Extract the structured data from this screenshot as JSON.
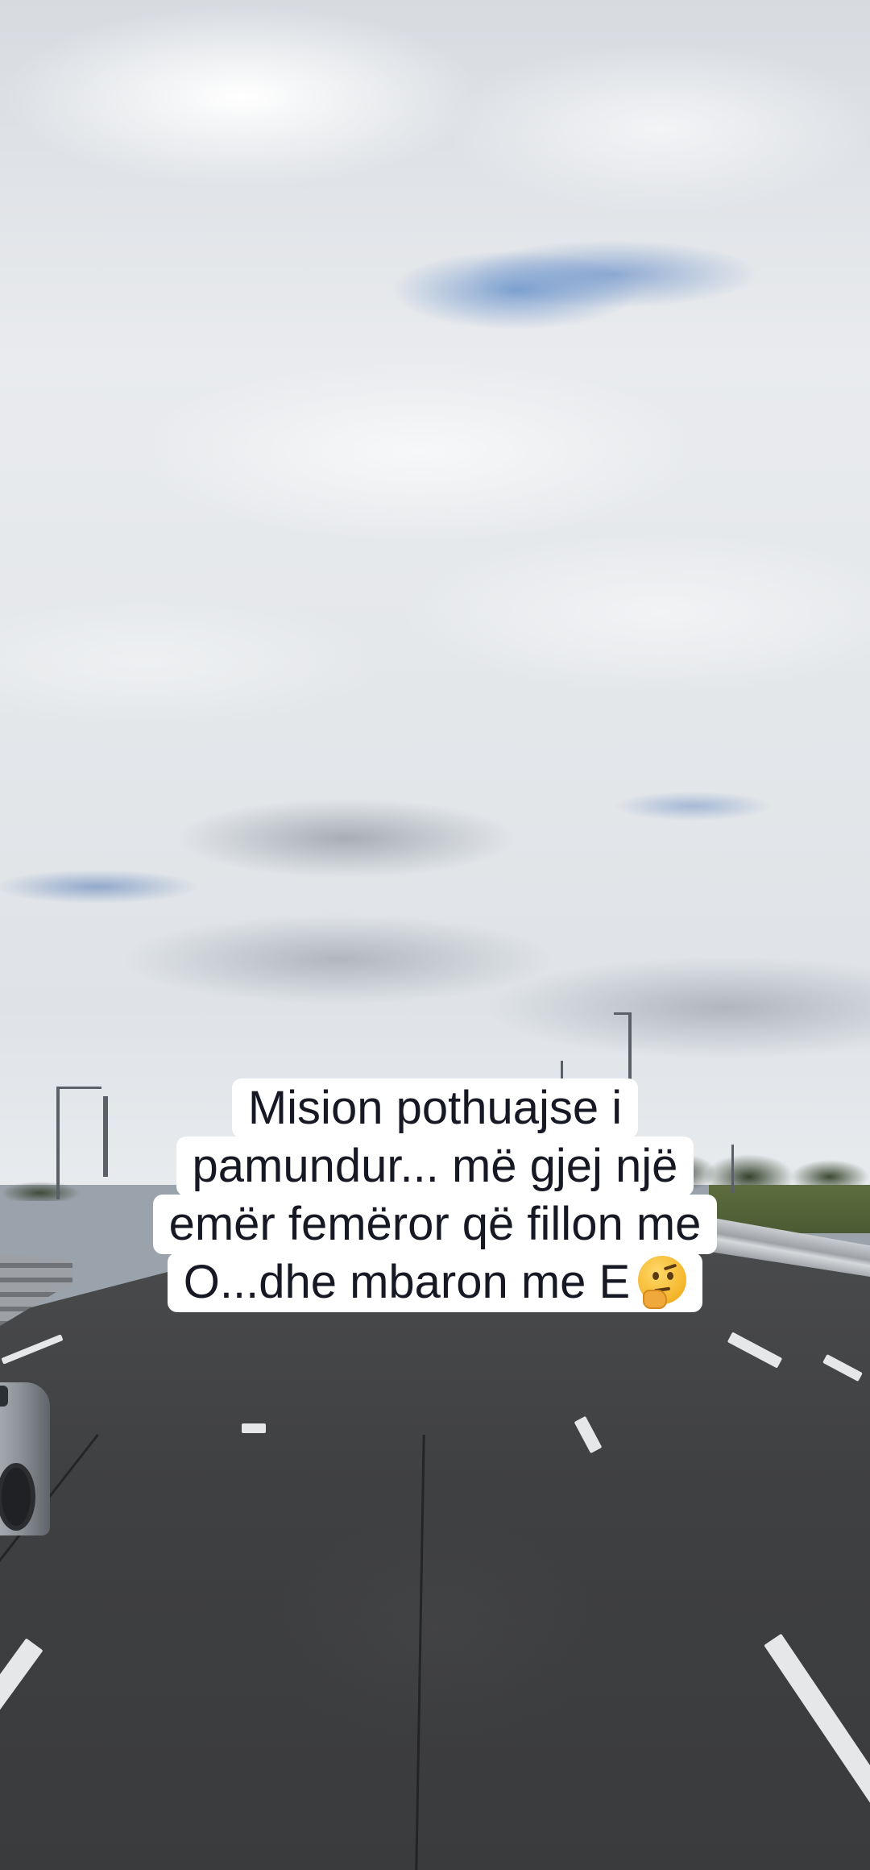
{
  "caption": {
    "lines": [
      "Mision pothuajse i",
      "pamundur... më gjej një",
      "emër femëror që fillon me",
      "O...dhe mbaron me E"
    ],
    "emoji": "thinking-face-emoji"
  }
}
